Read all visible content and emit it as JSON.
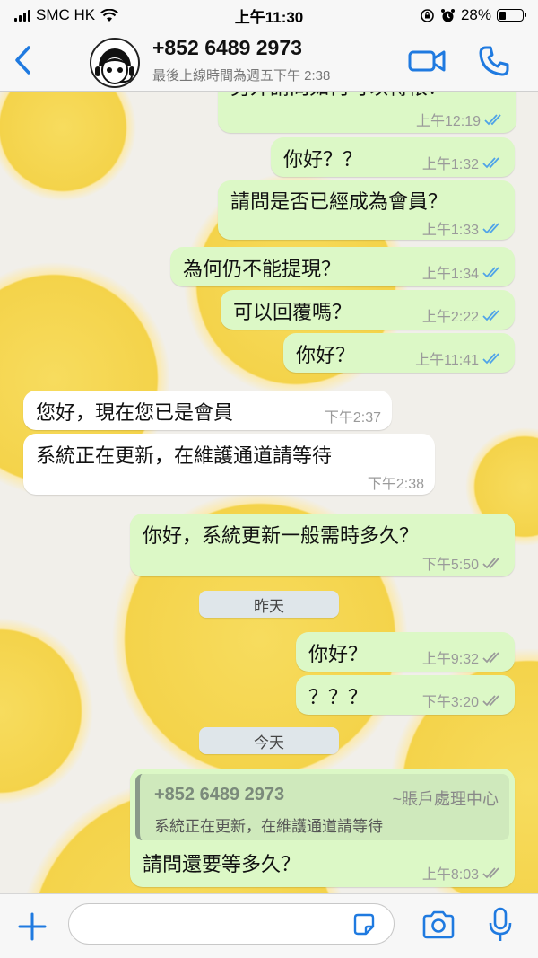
{
  "status_bar": {
    "carrier": "SMC HK",
    "time": "上午11:30",
    "battery": "28%",
    "battery_level": 0.28
  },
  "header": {
    "contact_name": "+852 6489 2973",
    "last_seen": "最後上線時間為週五下午 2:38",
    "icons": [
      "chevron-left-icon",
      "avatar",
      "video-icon",
      "phone-icon"
    ]
  },
  "chat": {
    "messages": [
      {
        "dir": "out",
        "text": "另外請問如何可以轉帳？",
        "time": "上午12:19",
        "status": "read"
      },
      {
        "dir": "out",
        "text": "你好？？",
        "time": "上午1:32",
        "status": "read"
      },
      {
        "dir": "out",
        "text": "請問是否已經成為會員？",
        "time": "上午1:33",
        "status": "read"
      },
      {
        "dir": "out",
        "text": "為何仍不能提現？",
        "time": "上午1:34",
        "status": "read"
      },
      {
        "dir": "out",
        "text": "可以回覆嗎？",
        "time": "上午2:22",
        "status": "read"
      },
      {
        "dir": "out",
        "text": "你好？",
        "time": "上午11:41",
        "status": "read"
      },
      {
        "dir": "in",
        "text": "您好，現在您已是會員",
        "time": "下午2:37"
      },
      {
        "dir": "in",
        "text": "系統正在更新，在維護通道請等待",
        "time": "下午2:38"
      },
      {
        "dir": "out",
        "text": "你好，系統更新一般需時多久？",
        "time": "下午5:50",
        "status": "delivered"
      },
      {
        "dir": "out",
        "text": "你好？",
        "time": "上午9:32",
        "status": "delivered"
      },
      {
        "dir": "out",
        "text": "？？？",
        "time": "下午3:20",
        "status": "delivered"
      },
      {
        "dir": "out",
        "text": "請問還要等多久？",
        "time": "上午8:03",
        "status": "delivered",
        "reply_to": {
          "name": "+852 6489 2973",
          "tag": "~賬戶處理中心",
          "text": "系統正在更新，在維護通道請等待"
        }
      }
    ],
    "date_separators": {
      "yesterday": "昨天",
      "today": "今天"
    }
  },
  "colors": {
    "outgoing": "#dcf8c6",
    "incoming": "#ffffff",
    "accent": "#1f7ae0",
    "read_ticks": "#4fa3e8"
  },
  "input_bar": {
    "icons": [
      "plus-icon",
      "sticker-icon",
      "camera-icon",
      "microphone-icon"
    ],
    "placeholder": ""
  }
}
